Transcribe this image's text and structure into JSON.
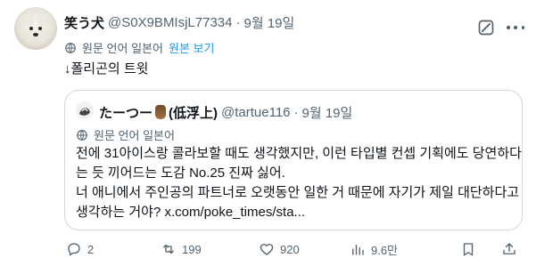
{
  "tweet": {
    "display_name": "笑う犬",
    "handle": "@S0X9BMIsjL77334",
    "separator": "·",
    "date": "9월 19일",
    "translate_label": "원문 언어 일본어",
    "translate_link": "원본 보기",
    "text": "↓폴리곤의 트윗"
  },
  "quote": {
    "display_name_a": "たーつー",
    "display_name_b": "(低浮上)",
    "handle": "@tartue116",
    "separator": "·",
    "date": "9월 19일",
    "translate_label": "원문 언어 일본어",
    "lines": [
      "전에 31아이스랑 콜라보할 때도 생각했지만, 이런 타입별 컨셉 기획에도 당연하다",
      "는 듯 끼어드는 도감 No.25 진짜 싫어.",
      "너 애니에서 주인공의 파트너로 오랫동안 일한 거 때문에 자기가 제일 대단하다고",
      "생각하는 거야? x.com/poke_times/sta..."
    ]
  },
  "actions": {
    "replies": "2",
    "retweets": "199",
    "likes": "920",
    "views": "9.6만"
  },
  "icons": [
    "grok-icon",
    "more-icon",
    "globe-icon",
    "reply-icon",
    "retweet-icon",
    "like-icon",
    "views-icon",
    "bookmark-icon",
    "share-icon"
  ],
  "colors": {
    "text": "#0f1419",
    "secondary": "#536471",
    "link": "#1d9bf0",
    "border": "#cfd9de"
  }
}
